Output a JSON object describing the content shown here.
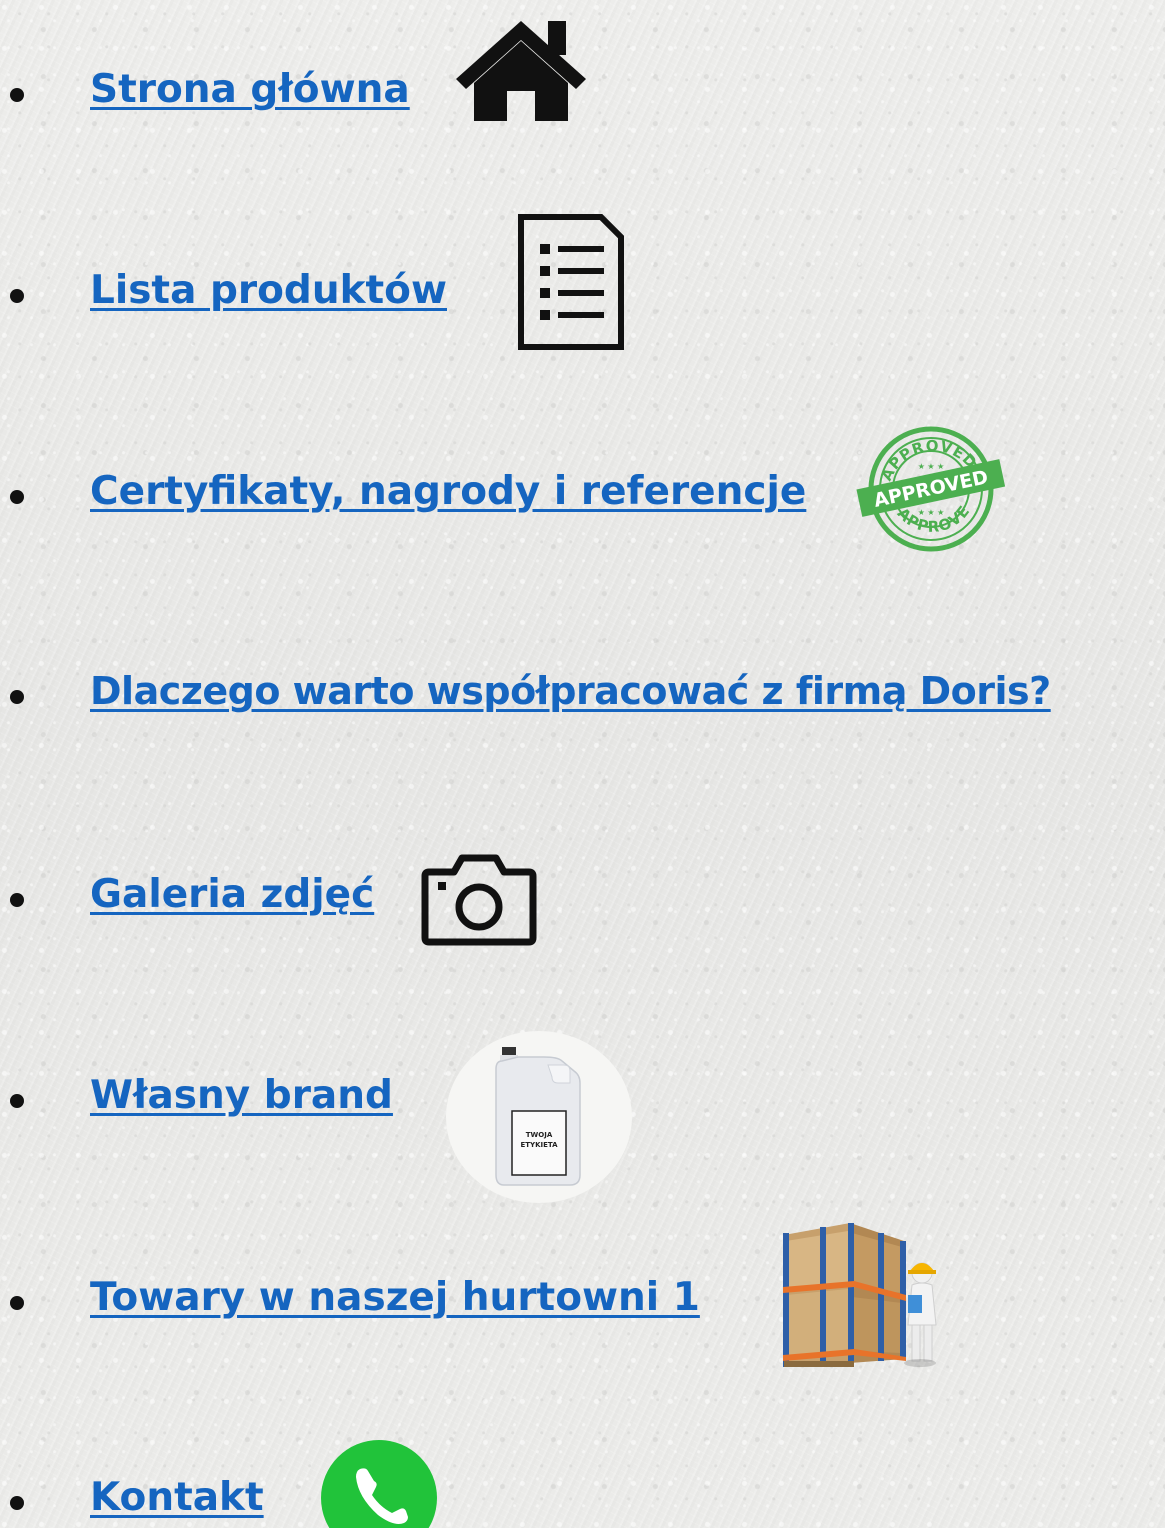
{
  "menu": {
    "items": [
      {
        "label": "Strona główna",
        "icon": "home-icon"
      },
      {
        "label": "Lista produktów",
        "icon": "list-document-icon"
      },
      {
        "label": "Certyfikaty, nagrody i referencje",
        "icon": "approved-stamp-icon"
      },
      {
        "label": "Dlaczego warto współpracować z firmą Doris?",
        "icon": ""
      },
      {
        "label": "Galeria zdjęć",
        "icon": "camera-icon"
      },
      {
        "label": "Własny brand",
        "icon": "canister-label-icon"
      },
      {
        "label": "Towary w naszej hurtowni 1",
        "icon": "warehouse-worker-icon"
      },
      {
        "label": "Kontakt",
        "icon": "phone-icon"
      }
    ]
  },
  "stamp": {
    "top_text": "APPROVED",
    "middle_text": "APPROVED",
    "bottom_text": "APPROVED"
  },
  "canister": {
    "label_line1": "TWOJA",
    "label_line2": "ETYKIETA"
  },
  "colors": {
    "link": "#1565c0",
    "bullet": "#111111",
    "stamp_green": "#4caf50",
    "phone_green": "#21c33a"
  }
}
